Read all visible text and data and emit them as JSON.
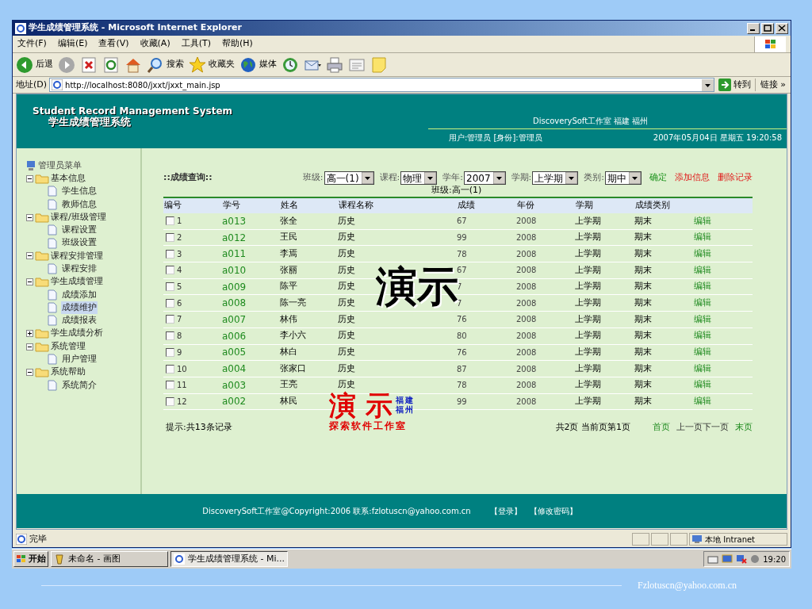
{
  "window": {
    "title": "学生成绩管理系统 - Microsoft Internet Explorer"
  },
  "menu": [
    "文件(F)",
    "编辑(E)",
    "查看(V)",
    "收藏(A)",
    "工具(T)",
    "帮助(H)"
  ],
  "toolbar": [
    {
      "kind": "back",
      "label": "后退"
    },
    {
      "kind": "forward"
    },
    {
      "kind": "stop"
    },
    {
      "kind": "refresh"
    },
    {
      "kind": "home"
    },
    {
      "kind": "search",
      "label": "搜索"
    },
    {
      "kind": "favorites",
      "label": "收藏夹"
    },
    {
      "kind": "media",
      "label": "媒体"
    },
    {
      "kind": "history"
    },
    {
      "kind": "mail"
    },
    {
      "kind": "print"
    },
    {
      "kind": "edit"
    },
    {
      "kind": "note"
    }
  ],
  "address": {
    "label": "地址(D)",
    "url": "http://localhost:8080/jxxt/jxxt_main.jsp",
    "go": "转到",
    "links": "链接",
    "more": "»"
  },
  "header": {
    "title_en": "Student Record Management System",
    "title_zh": "学生成绩管理系统",
    "org": "DiscoverySoft工作室 福建 福州",
    "user": "用户:管理员 [身份]:管理员",
    "datetime": "2007年05月04日 星期五 19:20:58"
  },
  "sidebar": {
    "root": "管理员菜单",
    "tree": [
      {
        "label": "基本信息",
        "expanded": true,
        "children": [
          {
            "label": "学生信息",
            "selected": false
          },
          {
            "label": "教师信息",
            "selected": false
          }
        ]
      },
      {
        "label": "课程/班级管理",
        "expanded": true,
        "children": [
          {
            "label": "课程设置",
            "selected": false
          },
          {
            "label": "班级设置",
            "selected": false
          }
        ]
      },
      {
        "label": "课程安排管理",
        "expanded": true,
        "children": [
          {
            "label": "课程安排",
            "selected": false
          }
        ]
      },
      {
        "label": "学生成绩管理",
        "expanded": true,
        "children": [
          {
            "label": "成绩添加",
            "selected": false
          },
          {
            "label": "成绩维护",
            "selected": true
          },
          {
            "label": "成绩报表",
            "selected": false
          }
        ]
      },
      {
        "label": "学生成绩分析",
        "expanded": false
      },
      {
        "label": "系统管理",
        "expanded": true,
        "children": [
          {
            "label": "用户管理",
            "selected": false
          }
        ]
      },
      {
        "label": "系统帮助",
        "expanded": true,
        "children": [
          {
            "label": "系统简介",
            "selected": false
          }
        ]
      }
    ]
  },
  "main": {
    "title": "::成绩查询::",
    "filters": [
      {
        "label": "班级:",
        "value": "高一(1)"
      },
      {
        "label": "课程:",
        "value": "物理"
      },
      {
        "label": "学年:",
        "value": "2007"
      },
      {
        "label": "学期:",
        "value": "上学期"
      },
      {
        "label": "类别:",
        "value": "期中"
      }
    ],
    "actions": [
      {
        "label": "确定",
        "kind": "confirm"
      },
      {
        "label": "添加信息",
        "kind": "danger"
      },
      {
        "label": "删除记录",
        "kind": "danger"
      }
    ],
    "subtitle": "班级:高一(1)",
    "table": {
      "columns": [
        "编号",
        "学号",
        "姓名",
        "课程名称",
        "成绩",
        "年份",
        "学期",
        "成绩类别"
      ],
      "rows": [
        {
          "checked": false,
          "no": "1",
          "id": "a013",
          "name": "张全",
          "course": "历史",
          "score": "67",
          "year": "2008",
          "term": "上学期",
          "type": "期末",
          "action": "编辑"
        },
        {
          "checked": false,
          "no": "2",
          "id": "a012",
          "name": "王民",
          "course": "历史",
          "score": "99",
          "year": "2008",
          "term": "上学期",
          "type": "期末",
          "action": "编辑"
        },
        {
          "checked": false,
          "no": "3",
          "id": "a011",
          "name": "李焉",
          "course": "历史",
          "score": "78",
          "year": "2008",
          "term": "上学期",
          "type": "期末",
          "action": "编辑"
        },
        {
          "checked": false,
          "no": "4",
          "id": "a010",
          "name": "张丽",
          "course": "历史",
          "score": "67",
          "year": "2008",
          "term": "上学期",
          "type": "期末",
          "action": "编辑"
        },
        {
          "checked": false,
          "no": "5",
          "id": "a009",
          "name": "陈平",
          "course": "历史",
          "score": "7",
          "year": "2008",
          "term": "上学期",
          "type": "期末",
          "action": "编辑"
        },
        {
          "checked": false,
          "no": "6",
          "id": "a008",
          "name": "陈一亮",
          "course": "历史",
          "score": "7",
          "year": "2008",
          "term": "上学期",
          "type": "期末",
          "action": "编辑"
        },
        {
          "checked": false,
          "no": "7",
          "id": "a007",
          "name": "林伟",
          "course": "历史",
          "score": "76",
          "year": "2008",
          "term": "上学期",
          "type": "期末",
          "action": "编辑"
        },
        {
          "checked": false,
          "no": "8",
          "id": "a006",
          "name": "李小六",
          "course": "历史",
          "score": "80",
          "year": "2008",
          "term": "上学期",
          "type": "期末",
          "action": "编辑"
        },
        {
          "checked": false,
          "no": "9",
          "id": "a005",
          "name": "林白",
          "course": "历史",
          "score": "76",
          "year": "2008",
          "term": "上学期",
          "type": "期末",
          "action": "编辑"
        },
        {
          "checked": false,
          "no": "10",
          "id": "a004",
          "name": "张家口",
          "course": "历史",
          "score": "87",
          "year": "2008",
          "term": "上学期",
          "type": "期末",
          "action": "编辑"
        },
        {
          "checked": false,
          "no": "11",
          "id": "a003",
          "name": "王亮",
          "course": "历史",
          "score": "78",
          "year": "2008",
          "term": "上学期",
          "type": "期末",
          "action": "编辑"
        },
        {
          "checked": false,
          "no": "12",
          "id": "a002",
          "name": "林民",
          "score": "99",
          "year": "2008",
          "term": "上学期",
          "type": "期末",
          "action": "编辑"
        }
      ]
    },
    "note": "提示:共13条记录",
    "page_info": "共2页 当前页第1页",
    "pager": [
      {
        "label": "首页",
        "disabled": false
      },
      {
        "label": "上一页",
        "disabled": true
      },
      {
        "label": "下一页",
        "disabled": true
      },
      {
        "label": "末页",
        "disabled": false
      }
    ]
  },
  "overlays": {
    "big": "演示",
    "stamp_main": "演 示",
    "stamp_side": [
      "福建",
      "福州"
    ],
    "stamp_sub": "探索软件工作室"
  },
  "footer": {
    "copyright": "DiscoverySoft工作室@Copyright:2006 联系:fzlotuscn@yahoo.com.cn",
    "links": [
      "【登录】",
      "【修改密码】"
    ]
  },
  "status_bar": {
    "text": "完毕",
    "zone": "本地 Intranet"
  },
  "taskbar": {
    "start": "开始",
    "tasks": [
      {
        "label": "未命名 - 画图",
        "selected": false
      },
      {
        "label": "学生成绩管理系统 - Mi...",
        "selected": true
      }
    ],
    "clock": "19:20"
  },
  "slide": {
    "email": "Fzlotuscn@yahoo.com.cn"
  }
}
